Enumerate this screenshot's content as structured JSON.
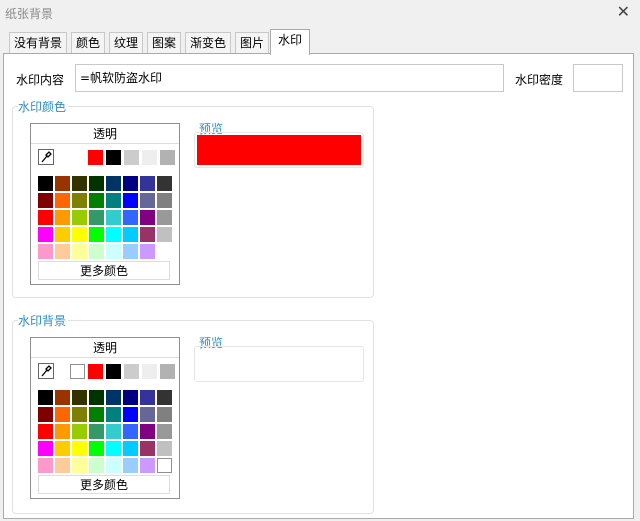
{
  "window": {
    "title": "纸张背景",
    "close": "✕"
  },
  "tabs": [
    {
      "label": "没有背景"
    },
    {
      "label": "颜色"
    },
    {
      "label": "纹理"
    },
    {
      "label": "图案"
    },
    {
      "label": "渐变色"
    },
    {
      "label": "图片"
    },
    {
      "label": "水印",
      "active": true
    }
  ],
  "form": {
    "content_label": "水印内容",
    "content_value": "=帆软防盗水印",
    "density_label": "水印密度",
    "density_value": ""
  },
  "watermark_color": {
    "label": "水印颜色",
    "transparent": "透明",
    "more_colors": "更多颜色",
    "recent": [
      "#ffffff",
      "#ff0000",
      "#000000",
      "#cccccc",
      "#eeeeee",
      "#b2b2b2"
    ],
    "selected_recent": null,
    "preview_label": "预览",
    "preview_color": "#ff0000"
  },
  "watermark_background": {
    "label": "水印背景",
    "transparent": "透明",
    "more_colors": "更多颜色",
    "recent": [
      "#ffffff",
      "#ff0000",
      "#000000",
      "#cccccc",
      "#eeeeee",
      "#b2b2b2"
    ],
    "selected_recent": 0,
    "preview_label": "预览",
    "preview_color": "#ffffff"
  },
  "palette_colors": [
    [
      "#000000",
      "#993300",
      "#333300",
      "#003300",
      "#003366",
      "#000080",
      "#333399",
      "#333333"
    ],
    [
      "#800000",
      "#ff6600",
      "#808000",
      "#008000",
      "#008080",
      "#0000ff",
      "#666699",
      "#808080"
    ],
    [
      "#ff0000",
      "#ff9900",
      "#99cc00",
      "#339966",
      "#33cccc",
      "#3366ff",
      "#800080",
      "#999999"
    ],
    [
      "#ff00ff",
      "#ffcc00",
      "#ffff00",
      "#00ff00",
      "#00ffff",
      "#00ccff",
      "#993366",
      "#c0c0c0"
    ],
    [
      "#ff99cc",
      "#ffcc99",
      "#ffff99",
      "#ccffcc",
      "#ccffff",
      "#99ccff",
      "#cc99ff",
      "#ffffff"
    ]
  ]
}
